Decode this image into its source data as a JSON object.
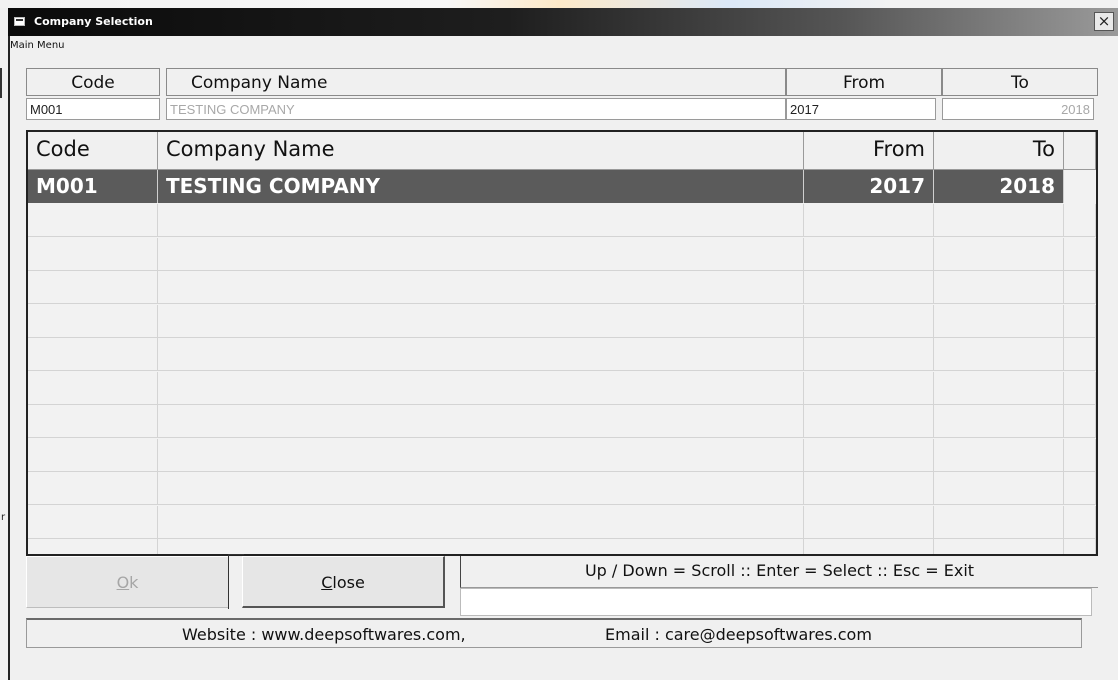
{
  "window": {
    "title": "Company Selection",
    "close_glyph": "×",
    "icon": "window-icon"
  },
  "menu": {
    "main_menu": "Main Menu"
  },
  "filter": {
    "headers": {
      "code": "Code",
      "company_name": "Company Name",
      "from": "From",
      "to": "To"
    },
    "values": {
      "code": "M001",
      "company_name": "TESTING COMPANY",
      "from": "2017",
      "to": "2018"
    }
  },
  "grid": {
    "columns": [
      "Code",
      "Company Name",
      "From",
      "To"
    ],
    "rows": [
      {
        "code": "M001",
        "company_name": "TESTING COMPANY",
        "from": "2017",
        "to": "2018",
        "selected": true
      }
    ],
    "selected_bg": "#5b5b5b"
  },
  "buttons": {
    "ok": "Ok",
    "close": "Close"
  },
  "hint": "Up / Down = Scroll  ::  Enter = Select  ::  Esc = Exit",
  "footer": {
    "website": "Website : www.deepsoftwares.com,",
    "email": "Email : care@deepsoftwares.com"
  },
  "stray_char": "r"
}
